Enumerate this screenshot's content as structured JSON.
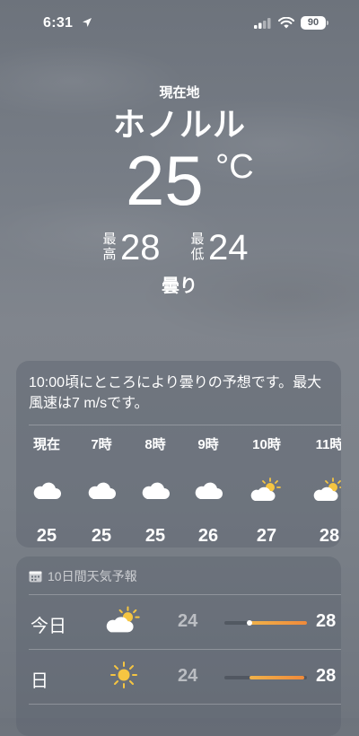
{
  "status_bar": {
    "time": "6:31",
    "battery": "90"
  },
  "header": {
    "location_label": "現在地",
    "city": "ホノルル",
    "temperature": "25",
    "unit": "°C",
    "high_label": [
      "最",
      "高"
    ],
    "high": "28",
    "low_label": [
      "最",
      "低"
    ],
    "low": "24",
    "condition": "曇り"
  },
  "hourly": {
    "summary": "10:00頃にところにより曇りの予想です。最大風速は7 m/sです。",
    "items": [
      {
        "label": "現在",
        "icon": "cloud-icon",
        "temp": "25"
      },
      {
        "label": "7時",
        "icon": "cloud-icon",
        "temp": "25"
      },
      {
        "label": "8時",
        "icon": "cloud-icon",
        "temp": "25"
      },
      {
        "label": "9時",
        "icon": "cloud-icon",
        "temp": "26"
      },
      {
        "label": "10時",
        "icon": "partly-sunny-icon",
        "temp": "27"
      },
      {
        "label": "11時",
        "icon": "partly-sunny-icon",
        "temp": "28"
      }
    ]
  },
  "daily": {
    "title": "10日間天気予報",
    "rows": [
      {
        "day": "今日",
        "icon": "partly-sunny-icon",
        "low": "24",
        "high": "28",
        "range_start": 0.3,
        "range_end": 1.0,
        "current": 0.3
      },
      {
        "day": "日",
        "icon": "sun-icon",
        "low": "24",
        "high": "28",
        "range_start": 0.3,
        "range_end": 0.97
      }
    ]
  },
  "colors": {
    "range_start": "#f0b24a",
    "range_end": "#f08a3a",
    "sun": "#f5c542"
  }
}
